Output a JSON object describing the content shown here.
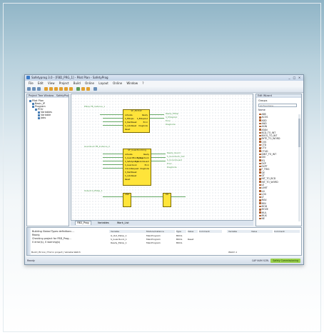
{
  "window": {
    "title": "Safetyprog 3.0 - [FBD_PRG_1] - Pilot Plan - SafetyProg",
    "menu": [
      "File",
      "Edit",
      "View",
      "Project",
      "Build",
      "Online",
      "Layout",
      "Online",
      "Window",
      "?"
    ],
    "controls": [
      "_",
      "□",
      "×"
    ]
  },
  "project_panel": {
    "title": "Project Tree Window - SafetyProg",
    "tree": [
      "Pilot Plan",
      "Basic_IP",
      "Program",
      "POU",
      "Variables",
      "Variable",
      "Jobs"
    ]
  },
  "diagram": {
    "block1": {
      "type": "SF_ESTOP",
      "pins_in": [
        "Activate",
        "S_EStopIn",
        "S_StartReset",
        "S_AutoReset",
        "Reset"
      ],
      "pins_out": [
        "Ready",
        "S_EStopOut",
        "Error",
        "DiagCode"
      ],
      "left_label": "EStop FB_Instance_1",
      "right_labels": [
        "Ready_EStop",
        "S_EStopOut",
        "Error",
        "DiagCode"
      ]
    },
    "block2": {
      "type": "SF_GuardLocking",
      "pins_in": [
        "Activate",
        "S_GuardMonitoring",
        "S_SafetyActive",
        "S_GuardLock",
        "UnlockRequest",
        "S_StartReset",
        "S_AutoReset",
        "Reset"
      ],
      "pins_out": [
        "Ready",
        "S_GuardLock",
        "S_UnlockGuard",
        "Error",
        "DiagCode"
      ],
      "left_label": "GuardLock FB_Instance_2",
      "right_labels": [
        "Ready_Guard",
        "S_GuardLock_Out",
        "S_UnlockGuard",
        "Error",
        "DiagCode"
      ]
    },
    "block3": {
      "left_label": "Output Q_EStop_1",
      "type": "AND"
    },
    "block4": {
      "type": "OR"
    },
    "tabs": [
      "FBD_Prog",
      "Variables",
      "Work_List"
    ]
  },
  "library_panel": {
    "title": "Edit Wizard",
    "group": "Groups",
    "filter": "All Functions",
    "name_header": "Name",
    "items": [
      "ABS",
      "ACOS",
      "ADD",
      "AND",
      "ASIN",
      "ATAN",
      "BCD_TO_INT",
      "BOOL_TO_INT",
      "BYTE_TO_WORD",
      "COS",
      "CTD",
      "CTU",
      "CTUD",
      "DINT_TO_INT",
      "DIV",
      "EQ",
      "EXP",
      "EXPT",
      "F_TRIG",
      "GE",
      "GT",
      "INT_TO_BCD",
      "INT_TO_WORD",
      "LE",
      "LIMIT",
      "LN",
      "LOG",
      "LT",
      "MAX",
      "MIN",
      "MOD",
      "MOVE",
      "MUL",
      "MUX",
      "NE"
    ]
  },
  "messages": {
    "lines": [
      "Building Global Types definitions ...",
      "Ready.",
      "Checking project for FBD_Prog...",
      "0 error(s), 0 warning(s)"
    ],
    "tabs": [
      "Build",
      "Errors",
      "Find in project",
      "Variable Watch"
    ]
  },
  "variables": {
    "columns": [
      "Variable",
      "Module/Instance",
      "Type",
      "Value",
      "Comment"
    ],
    "rows": [
      [
        "Q_Out_Estop_1",
        "MainProgram",
        "BOOL",
        ""
      ],
      [
        "S_GuardLock_1",
        "MainProgram",
        "BOOL",
        "Reset"
      ],
      [
        "Ready_Estop_1",
        "MainProgram",
        "BOOL",
        ""
      ]
    ],
    "right_columns": [
      "Variable",
      "Value",
      "Comment"
    ],
    "tab": "Watch 1"
  },
  "status": {
    "left": "Ready",
    "position": "CAP   NUM   SCRL",
    "badge": "Safety Commissioning"
  }
}
